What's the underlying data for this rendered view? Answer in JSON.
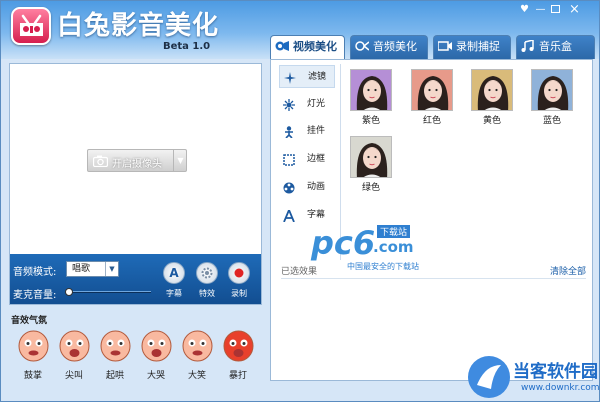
{
  "app": {
    "title": "白兔影音美化",
    "version": "Beta 1.0"
  },
  "window_controls": {
    "skin": "♥",
    "min": "—",
    "max": "□",
    "close": "×"
  },
  "tabs": [
    {
      "label": "视频美化",
      "icon": "video-icon",
      "active": true
    },
    {
      "label": "音频美化",
      "icon": "audio-icon",
      "active": false
    },
    {
      "label": "录制捕捉",
      "icon": "record-icon",
      "active": false
    },
    {
      "label": "音乐盒",
      "icon": "music-note-icon",
      "active": false
    }
  ],
  "camera": {
    "open_label": "开启摄像头"
  },
  "audio": {
    "mode_label": "音频模式:",
    "mode_value": "唱歌",
    "mic_label": "麦克音量:",
    "mic_volume": 0,
    "buttons": [
      {
        "glyph": "A",
        "label": "字幕"
      },
      {
        "label": "特效"
      },
      {
        "label": "录制"
      }
    ]
  },
  "sound_effects": {
    "title": "音效气氛",
    "items": [
      {
        "label": "鼓掌",
        "color": "#f9b9a0"
      },
      {
        "label": "尖叫",
        "color": "#f9b9a0"
      },
      {
        "label": "起哄",
        "color": "#f9b9a0"
      },
      {
        "label": "大哭",
        "color": "#f9b9a0"
      },
      {
        "label": "大笑",
        "color": "#f9b9a0"
      },
      {
        "label": "暴打",
        "color": "#e8402c"
      }
    ]
  },
  "side_menu": [
    {
      "label": "滤镜",
      "icon": "filter-sparkle-icon",
      "active": true
    },
    {
      "label": "灯光",
      "icon": "light-burst-icon",
      "active": false
    },
    {
      "label": "挂件",
      "icon": "pendant-figure-icon",
      "active": false
    },
    {
      "label": "边框",
      "icon": "frame-border-icon",
      "active": false
    },
    {
      "label": "动画",
      "icon": "film-reel-icon",
      "active": false
    },
    {
      "label": "字幕",
      "icon": "letter-a-icon",
      "active": false
    }
  ],
  "filters": [
    {
      "label": "紫色",
      "tint": "#b58fd6"
    },
    {
      "label": "红色",
      "tint": "#e79a8a"
    },
    {
      "label": "黄色",
      "tint": "#d9bb7a"
    },
    {
      "label": "蓝色",
      "tint": "#8fb2d9"
    },
    {
      "label": "绿色",
      "tint": "#d8d8d0"
    }
  ],
  "selected": {
    "label": "已选效果",
    "clear_all": "清除全部"
  },
  "pc6_watermark": {
    "brand": "pc6",
    "tld": ".com",
    "badge": "下载站",
    "slogan": "中国最安全的下载站"
  },
  "downkr_watermark": {
    "title": "当客软件园",
    "url": "www.downkr.com"
  },
  "colors": {
    "title_bar": "#4d9be3",
    "audio_bar": "#1f6bb8",
    "active_tab_text": "#1d4f86",
    "record_red": "#e02424"
  }
}
